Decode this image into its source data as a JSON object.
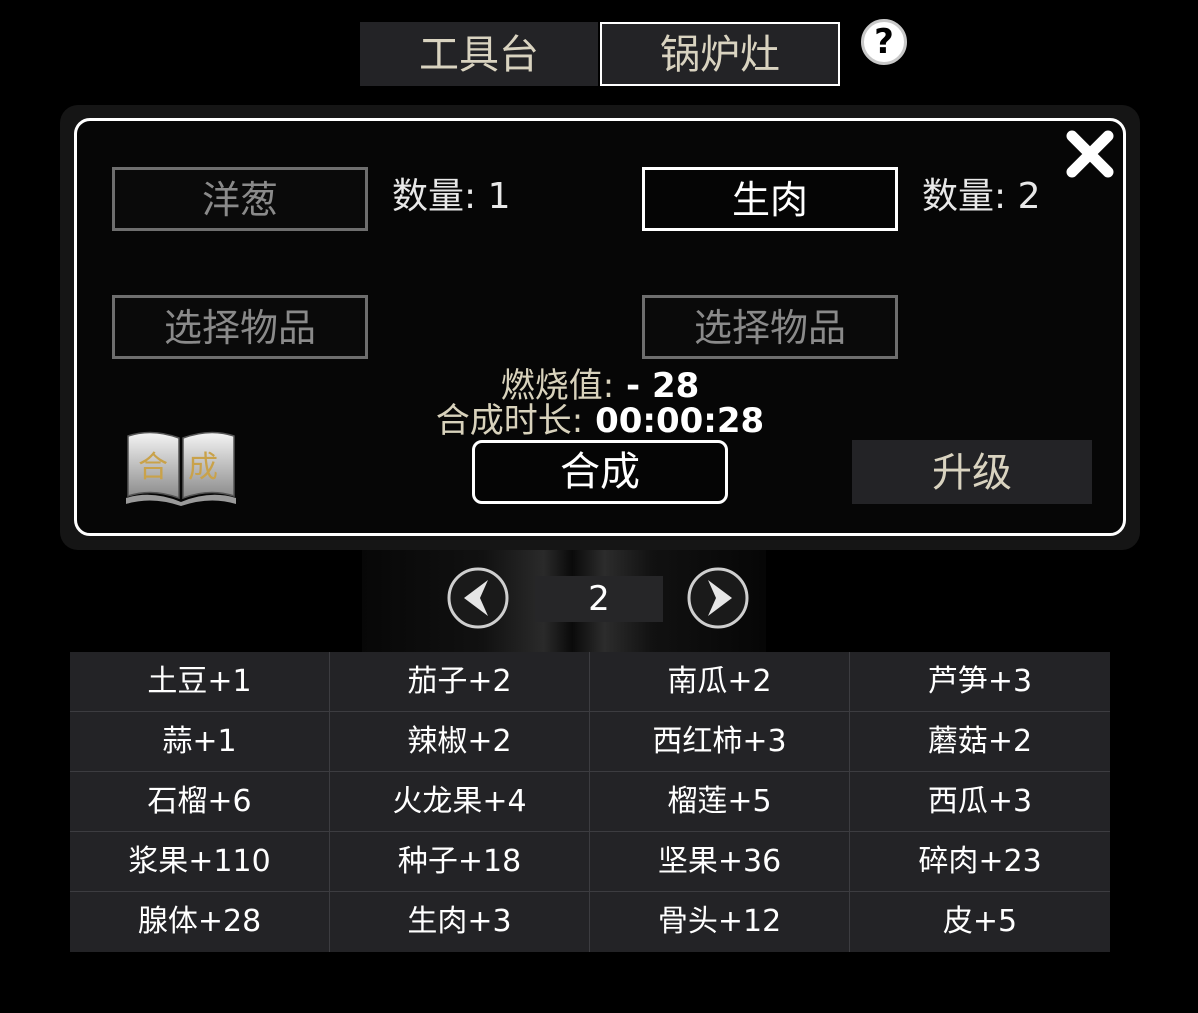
{
  "tabs": [
    {
      "label": "工具台",
      "active": false
    },
    {
      "label": "锅炉灶",
      "active": true
    }
  ],
  "help_label": "?",
  "dialog": {
    "slots": [
      {
        "label": "洋葱",
        "quantity_text": "数量: 1",
        "highlighted": false
      },
      {
        "label": "生肉",
        "quantity_text": "数量: 2",
        "highlighted": true
      },
      {
        "label": "选择物品"
      },
      {
        "label": "选择物品"
      }
    ],
    "burn_label": "燃烧值:",
    "burn_value": " - 28",
    "duration_label": "合成时长:",
    "duration_value": " 00:00:28",
    "book_text_left": "合",
    "book_text_right": "成",
    "synth_label": "合成",
    "upgrade_label": "升级"
  },
  "pager": {
    "page": "2"
  },
  "items": [
    "土豆+1",
    "茄子+2",
    "南瓜+2",
    "芦笋+3",
    "蒜+1",
    "辣椒+2",
    "西红柿+3",
    "蘑菇+2",
    "石榴+6",
    "火龙果+4",
    "榴莲+5",
    "西瓜+3",
    "浆果+110",
    "种子+18",
    "坚果+36",
    "碎肉+23",
    "腺体+28",
    "生肉+3",
    "骨头+12",
    "皮+5"
  ],
  "colors": {
    "accent_text": "#d9d3c0",
    "panel": "#232326",
    "background": "#000000"
  }
}
